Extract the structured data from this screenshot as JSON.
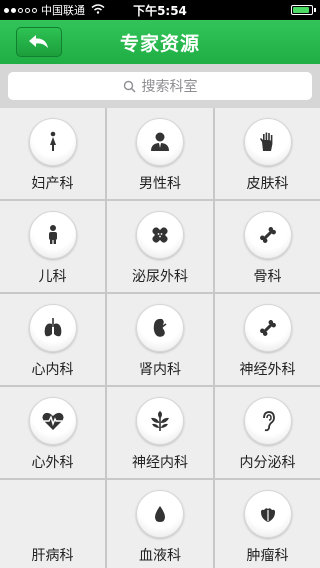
{
  "status_bar": {
    "carrier": "中国联通",
    "time": "下午5:54"
  },
  "nav": {
    "title": "专家资源"
  },
  "search": {
    "placeholder": "搜索科室"
  },
  "departments": [
    {
      "label": "妇产科",
      "icon": "female-icon"
    },
    {
      "label": "男性科",
      "icon": "male-icon"
    },
    {
      "label": "皮肤科",
      "icon": "hand-icon"
    },
    {
      "label": "儿科",
      "icon": "child-icon"
    },
    {
      "label": "泌尿外科",
      "icon": "bandage-icon"
    },
    {
      "label": "骨科",
      "icon": "bone-icon"
    },
    {
      "label": "心内科",
      "icon": "lungs-icon"
    },
    {
      "label": "肾内科",
      "icon": "kidney-icon"
    },
    {
      "label": "神经外科",
      "icon": "bone-icon"
    },
    {
      "label": "心外科",
      "icon": "heartbeat-icon"
    },
    {
      "label": "神经内科",
      "icon": "leaf-icon"
    },
    {
      "label": "内分泌科",
      "icon": "ear-icon"
    },
    {
      "label": "肝病科",
      "icon": "none"
    },
    {
      "label": "血液科",
      "icon": "drop-icon"
    },
    {
      "label": "肿瘤科",
      "icon": "tulip-icon"
    }
  ]
}
